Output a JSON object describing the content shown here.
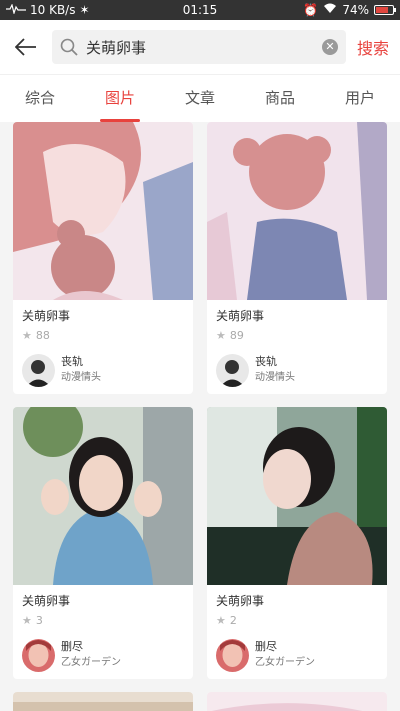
{
  "status_bar": {
    "speed": "10 KB/s",
    "time": "01:15",
    "battery": "74%",
    "battery_level": 0.74
  },
  "search": {
    "query": "关萌卵事",
    "submit_label": "搜索"
  },
  "tabs": [
    {
      "label": "综合",
      "active": false
    },
    {
      "label": "图片",
      "active": true
    },
    {
      "label": "文章",
      "active": false
    },
    {
      "label": "商品",
      "active": false
    },
    {
      "label": "用户",
      "active": false
    }
  ],
  "cards": [
    {
      "title": "关萌卵事",
      "stars": "88",
      "author": "丧轨",
      "author_sub": "动漫情头"
    },
    {
      "title": "关萌卵事",
      "stars": "89",
      "author": "丧轨",
      "author_sub": "动漫情头"
    },
    {
      "title": "关萌卵事",
      "stars": "3",
      "author": "删尽",
      "author_sub": "乙女ガーデン"
    },
    {
      "title": "关萌卵事",
      "stars": "2",
      "author": "删尽",
      "author_sub": "乙女ガーデン"
    }
  ],
  "colors": {
    "accent": "#e8423d",
    "status_bar": "#333333"
  }
}
